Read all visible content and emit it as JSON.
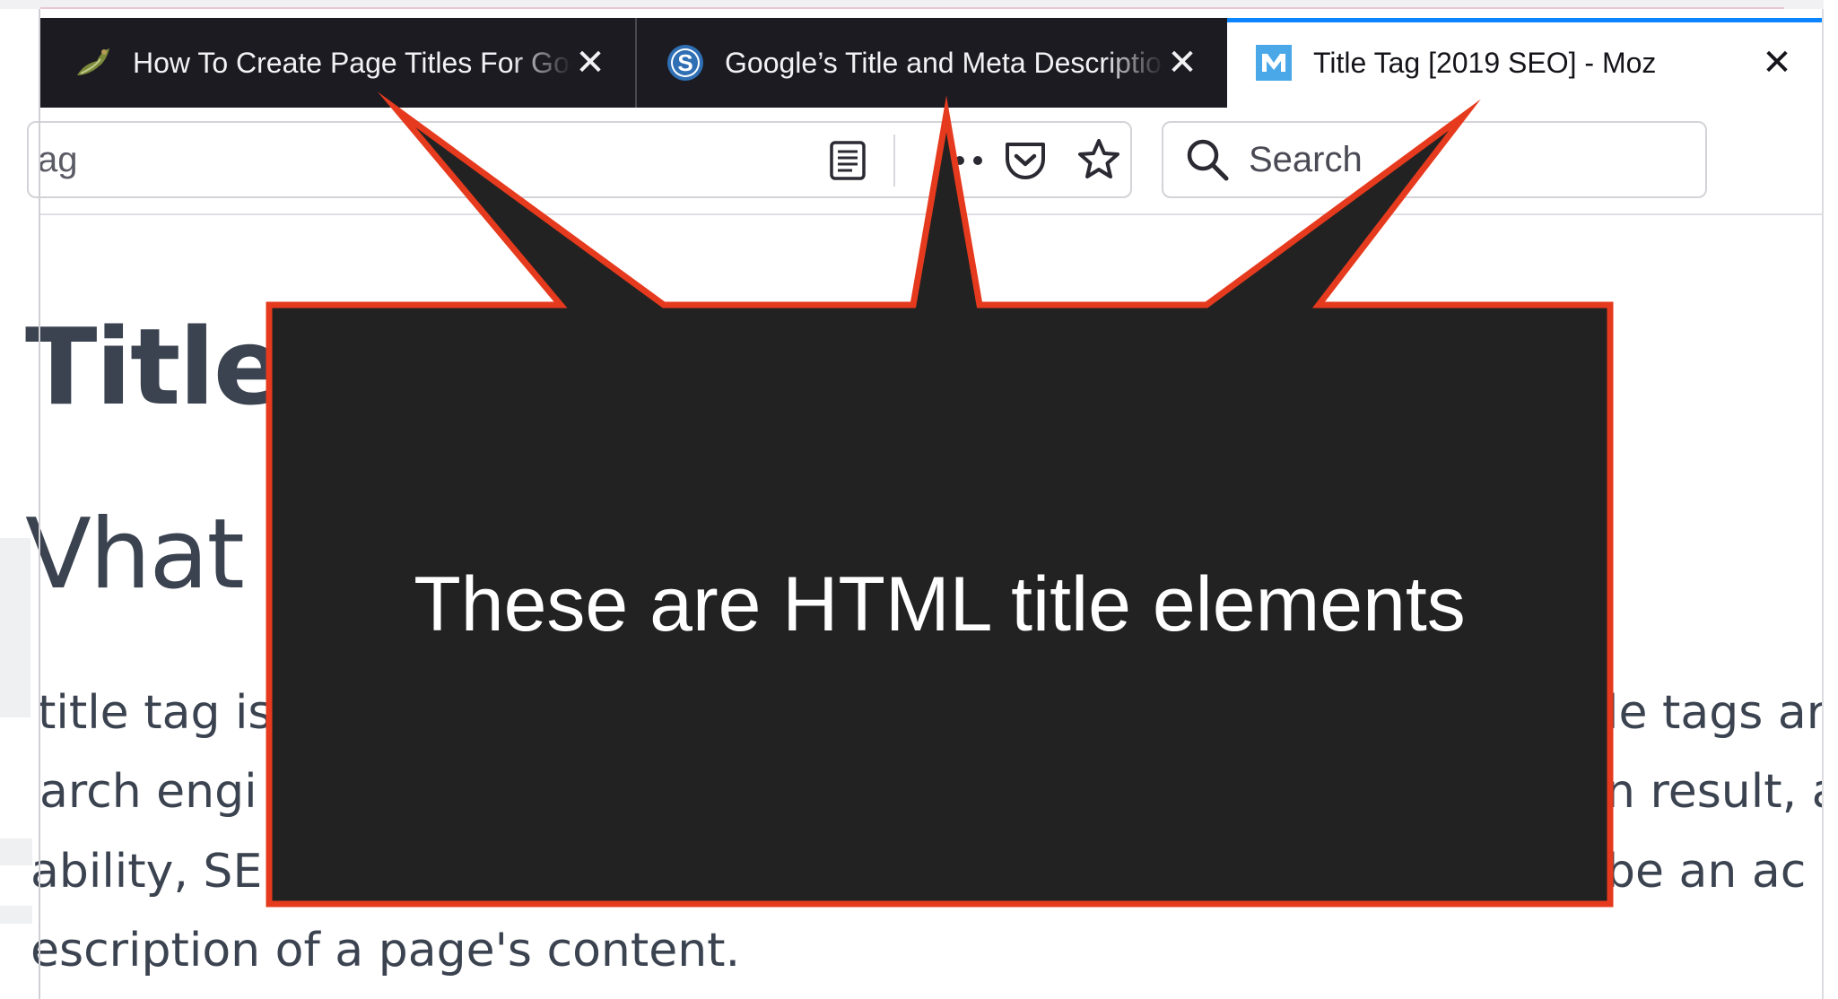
{
  "browser": {
    "tabs": [
      {
        "title": "How To Create Page Titles For Google",
        "favicon": "leaf-icon",
        "active": false
      },
      {
        "title": "Google’s Title and Meta Description",
        "favicon": "s-logo-icon",
        "active": false
      },
      {
        "title": "Title Tag [2019 SEO] - Moz",
        "favicon": "moz-m-icon",
        "active": true
      }
    ],
    "tab_close_glyph": "✕",
    "url_partial": "ag",
    "search_placeholder": "Search",
    "toolbar_icons": [
      "reader-view-icon",
      "more-actions-icon",
      "pocket-icon",
      "bookmark-star-icon",
      "search-icon"
    ]
  },
  "page": {
    "heading_partial": "Title T",
    "subheading_partial": "Vhat",
    "body_lines_left": [
      "title tag is",
      "arch engi",
      "ability, SE",
      "escription of a page's content."
    ],
    "body_lines_right": [
      "le tags are",
      "n result, a",
      "be an ac"
    ]
  },
  "callout": {
    "text": "These are HTML title elements"
  },
  "colors": {
    "tabbar_bg": "#1c1b22",
    "active_tab_accent": "#0a84ff",
    "callout_fill": "#222222",
    "callout_border": "#e63a1e",
    "moz_brand": "#4aa8e8"
  }
}
